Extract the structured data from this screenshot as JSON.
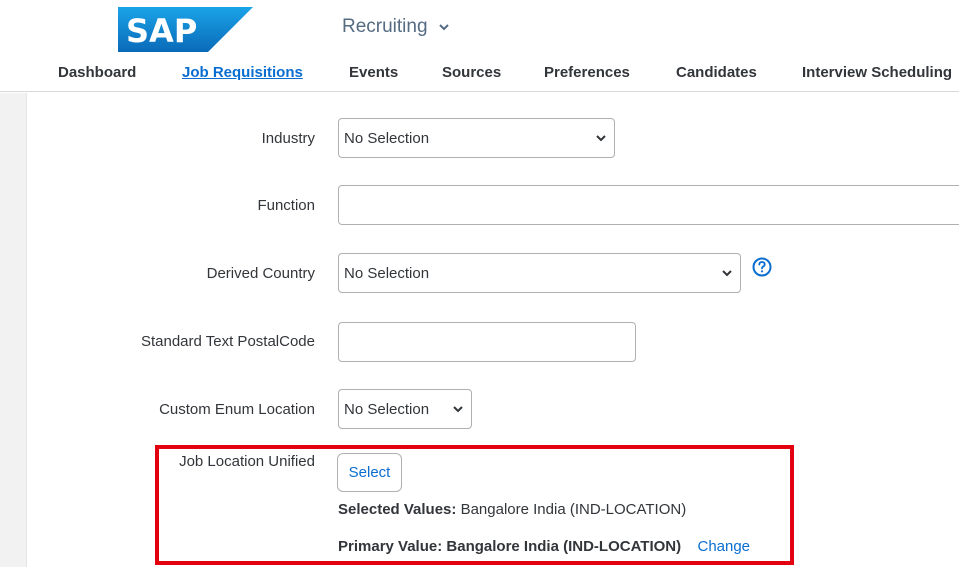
{
  "header": {
    "brand": "SAP",
    "module": "Recruiting"
  },
  "nav": {
    "items": [
      {
        "label": "Dashboard"
      },
      {
        "label": "Job Requisitions"
      },
      {
        "label": "Events"
      },
      {
        "label": "Sources"
      },
      {
        "label": "Preferences"
      },
      {
        "label": "Candidates"
      },
      {
        "label": "Interview Scheduling"
      }
    ],
    "active": "Job Requisitions"
  },
  "form": {
    "industry": {
      "label": "Industry",
      "value": "No Selection"
    },
    "function": {
      "label": "Function",
      "value": ""
    },
    "derived_country": {
      "label": "Derived Country",
      "value": "No Selection"
    },
    "postal_code": {
      "label": "Standard Text PostalCode",
      "value": ""
    },
    "custom_enum_location": {
      "label": "Custom Enum Location",
      "value": "No Selection"
    },
    "job_location": {
      "label": "Job Location Unified",
      "select_label": "Select",
      "selected_values_label": "Selected Values:",
      "selected_values": "Bangalore India (IND-LOCATION)",
      "primary_value_label": "Primary Value:",
      "primary_value": "Bangalore India (IND-LOCATION)",
      "change_label": "Change"
    }
  },
  "colors": {
    "accent": "#0a6ed1",
    "highlight": "#e3000f",
    "text": "#32363a"
  },
  "icons": {
    "help": "help-circle-icon",
    "dropdown": "chevron-down-icon"
  }
}
